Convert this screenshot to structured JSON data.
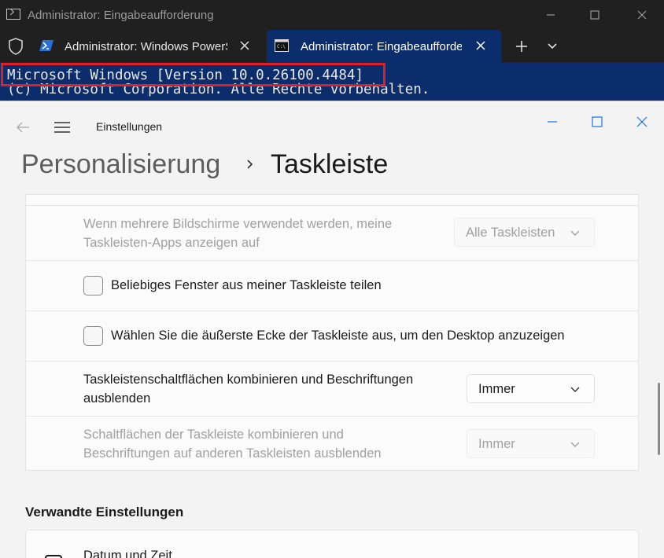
{
  "terminal": {
    "window_title": "Administrator: Eingabeaufforderung",
    "tabs": [
      {
        "label": "Administrator: Windows PowerShell",
        "active": false
      },
      {
        "label": "Administrator: Eingabeaufforderung",
        "active": true
      }
    ],
    "console_lines": [
      "Microsoft Windows [Version 10.0.26100.4484]",
      "(c) Microsoft Corporation. Alle Rechte vorbehalten."
    ],
    "colors": {
      "titlebar": "#202020",
      "active_tab": "#0c2d6b",
      "highlight_border": "#e01e26"
    }
  },
  "settings": {
    "app_title": "Einstellungen",
    "breadcrumb": {
      "parent": "Personalisierung",
      "current": "Taskleiste"
    },
    "rows": [
      {
        "text_line1": "Wenn mehrere Bildschirme verwendet werden, meine",
        "text_line2": "Taskleisten-Apps anzeigen auf",
        "dropdown": "Alle Taskleisten",
        "enabled": false
      },
      {
        "checkbox_label": "Beliebiges Fenster aus meiner Taskleiste teilen",
        "checked": false
      },
      {
        "checkbox_label": "Wählen Sie die äußerste Ecke der Taskleiste aus, um den Desktop anzuzeigen",
        "checked": false
      },
      {
        "text_line1": "Taskleistenschaltflächen kombinieren und Beschriftungen",
        "text_line2": "ausblenden",
        "dropdown": "Immer",
        "enabled": true
      },
      {
        "text_line1": "Schaltflächen der Taskleiste kombinieren und",
        "text_line2": "Beschriftungen auf anderen Taskleisten ausblenden",
        "dropdown": "Immer",
        "enabled": false
      }
    ],
    "related": {
      "heading": "Verwandte Einstellungen",
      "items": [
        {
          "label": "Datum und Zeit"
        }
      ]
    }
  }
}
